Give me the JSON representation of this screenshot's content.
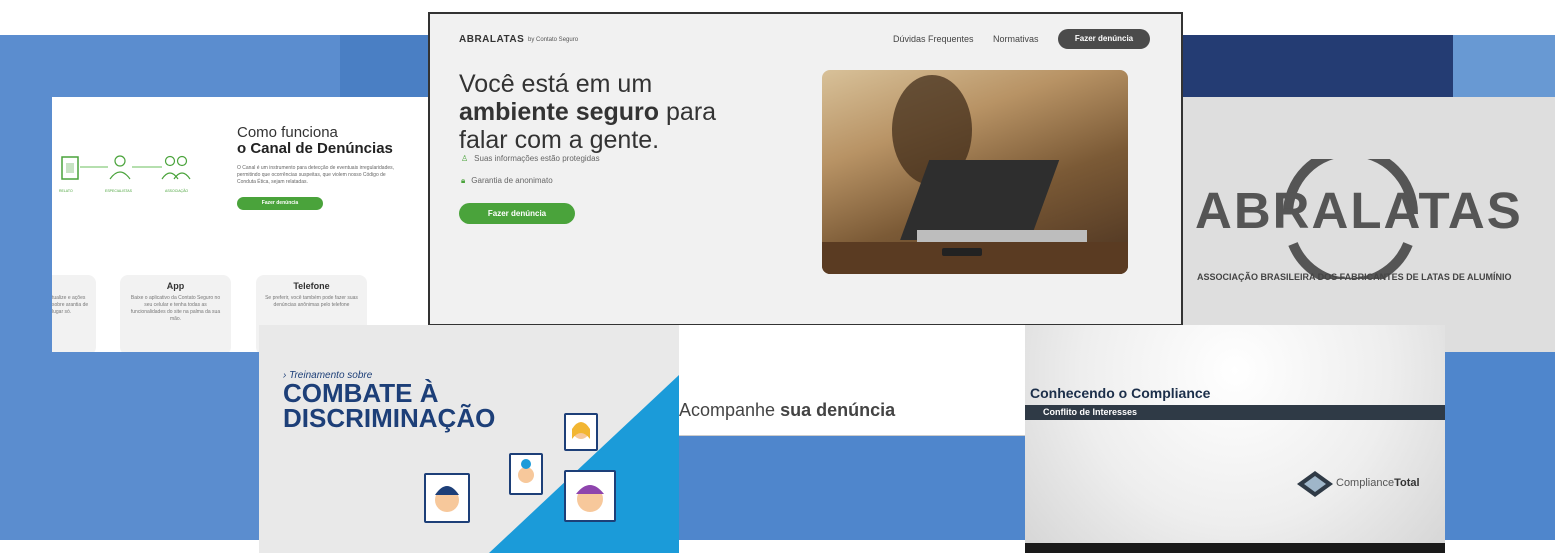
{
  "panel_canal": {
    "title_line1": "Como funciona",
    "title_line2": "o Canal de Denúncias",
    "description": "O Canal é um instrumento para detecção de eventuais irregularidades, permitindo que ocorrências suspeitas, que violem nosso Código de Conduta Ética, sejam relatadas.",
    "button": "Fazer denúncia",
    "steps": [
      "RELATO",
      "ESPECIALISTAS",
      "ASSOCIAÇÃO"
    ],
    "card_left_text": "tualize e ações sobre arantia de lugar só.",
    "card_app_title": "App",
    "card_app_text": "Baixe o aplicativo da Contato Seguro no seu celular e tenha todas as funcionalidades do site na palma da sua mão.",
    "card_phone_title": "Telefone",
    "card_phone_text": "Se preferir, você também pode fazer suas denúncias anônimas pelo telefone"
  },
  "panel_hero": {
    "logo": "ABRALATAS",
    "by": "by Contato Seguro",
    "nav": [
      "Dúvidas Frequentes",
      "Normativas"
    ],
    "nav_button": "Fazer denúncia",
    "headline_1": "Você está em um",
    "headline_bold": "ambiente seguro",
    "headline_2": " para",
    "headline_3": "falar com a gente.",
    "features": [
      "Suas informações estão protegidas",
      "Garantia de anonimato"
    ],
    "cta": "Fazer denúncia"
  },
  "panel_logo": {
    "logo": "ABRALATAS",
    "subtitle": "ASSOCIAÇÃO BRASILEIRA DOS FABRICANTES DE LATAS DE ALUMÍNIO"
  },
  "panel_training": {
    "kicker": "Treinamento sobre",
    "title_1": "COMBATE À",
    "title_2": "DISCRIMINAÇÃO"
  },
  "panel_track": {
    "text_1": "Acompanhe ",
    "text_bold": "sua denúncia"
  },
  "panel_compliance": {
    "title": "Conhecendo o Compliance",
    "bar": "Conflito de Interesses",
    "logo_1": "Compliance",
    "logo_2": "Total"
  },
  "colors": {
    "green": "#4aa33b",
    "navy": "#1d3f78",
    "blue": "#4f86cc"
  }
}
